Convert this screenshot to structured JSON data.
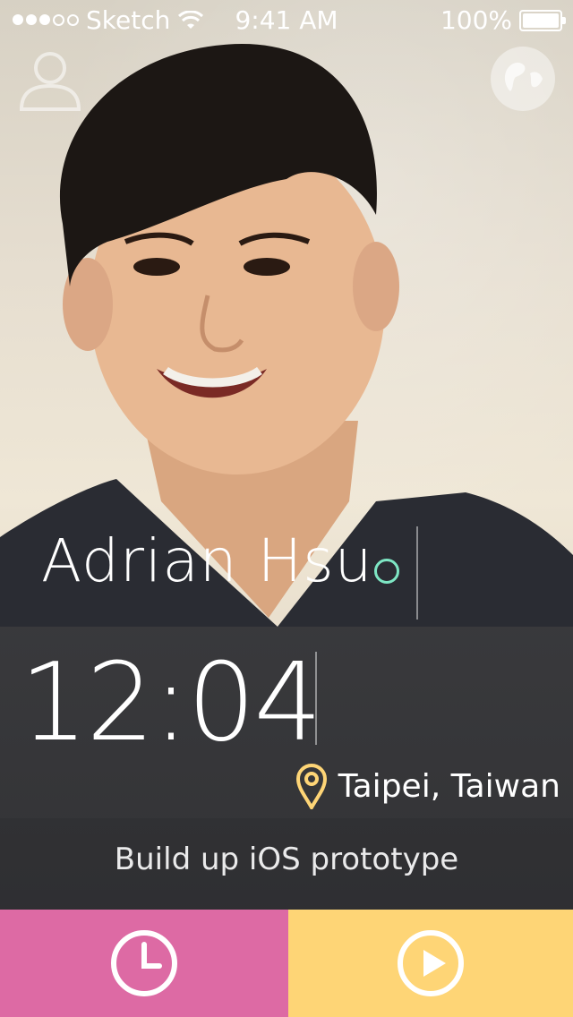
{
  "status_bar": {
    "carrier": "Sketch",
    "time": "9:41 AM",
    "battery": "100%"
  },
  "profile": {
    "name": "Adrian Hsu",
    "status_color": "#7ee6c4"
  },
  "clock": {
    "time": "12:04"
  },
  "location": {
    "text": "Taipei, Taiwan"
  },
  "task": {
    "text": "Build up iOS prototype"
  },
  "actions": {
    "left_color": "#dd6aa4",
    "right_color": "#fed576",
    "left_icon": "clock-icon",
    "right_icon": "play-icon"
  }
}
